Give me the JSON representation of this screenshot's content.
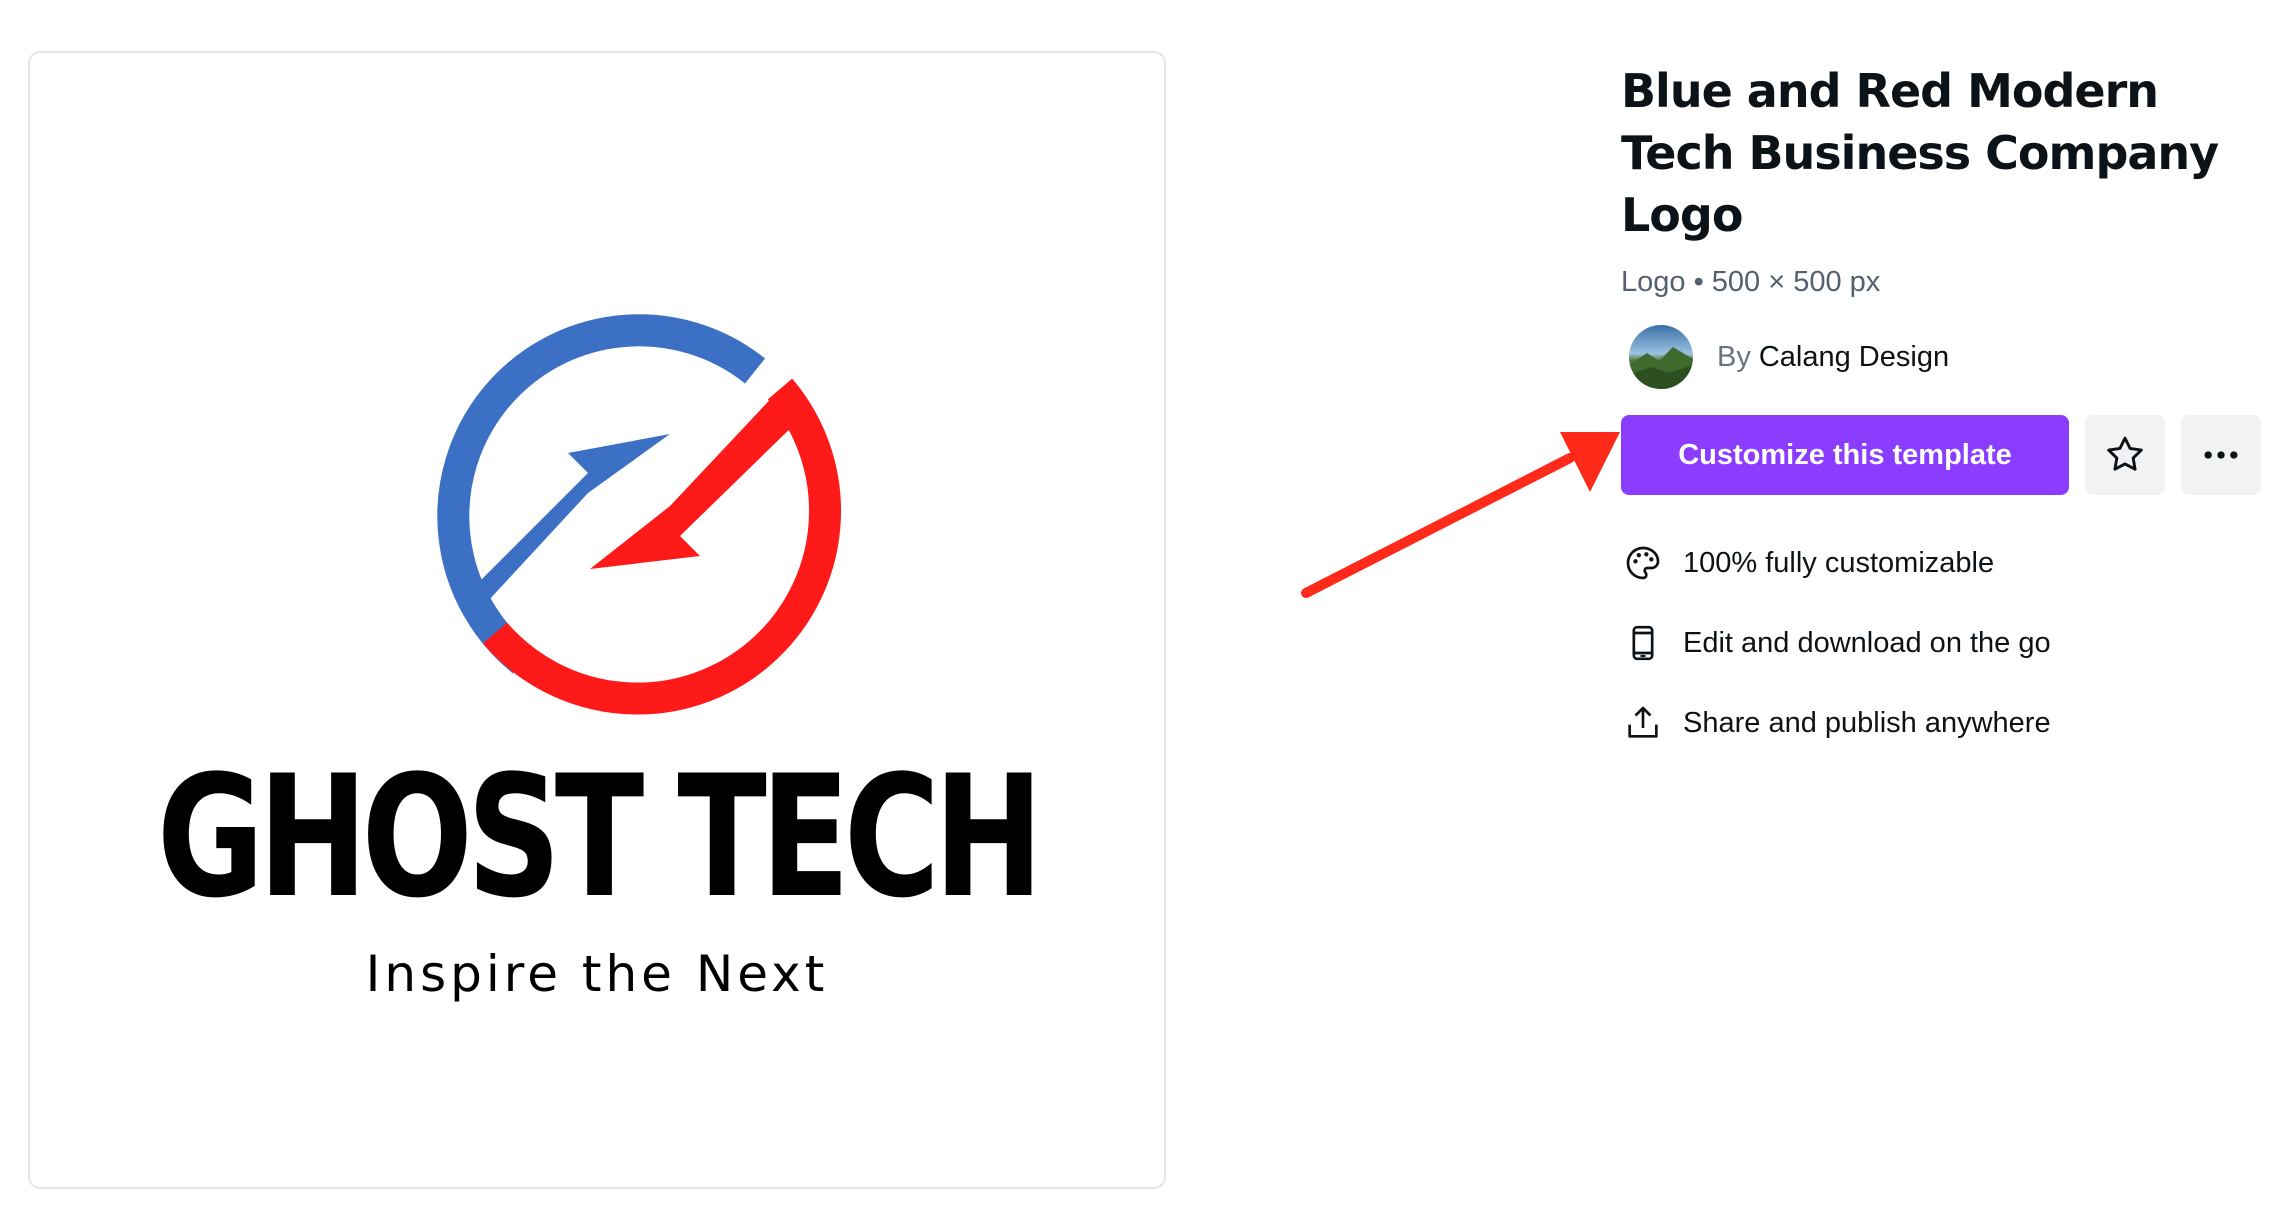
{
  "preview": {
    "logo_name": "GHOST TECH",
    "logo_tagline": "Inspire the Next",
    "logo_colors": {
      "blue": "#3b70c4",
      "red": "#ff1a1a"
    }
  },
  "template": {
    "title": "Blue and Red Modern Tech Business Company Logo",
    "meta": "Logo • 500 × 500 px",
    "author_by": "By",
    "author_name": "Calang Design"
  },
  "actions": {
    "customize_label": "Customize this template",
    "favorite_icon": "star-icon",
    "more_icon": "more-options-icon"
  },
  "features": [
    {
      "icon": "palette-icon",
      "label": "100% fully customizable"
    },
    {
      "icon": "phone-icon",
      "label": "Edit and download on the go"
    },
    {
      "icon": "share-icon",
      "label": "Share and publish anywhere"
    }
  ],
  "colors": {
    "accent": "#8b3dff",
    "annotation_arrow": "#ff2a1a"
  }
}
